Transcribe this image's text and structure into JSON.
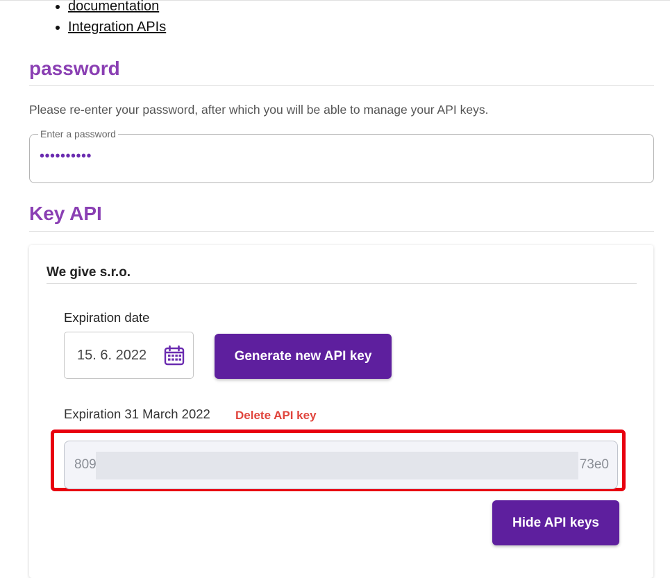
{
  "nav_links": [
    "documentation",
    "Integration APIs"
  ],
  "password_section": {
    "title": "password",
    "hint": "Please re-enter your password, after which you will be able to manage your API keys.",
    "field_label": "Enter a password",
    "field_value": "••••••••••"
  },
  "key_section": {
    "title": "Key API",
    "company": "We give s.r.o.",
    "expiration_label": "Expiration date",
    "date_value": "15. 6. 2022",
    "generate_button": "Generate new API key",
    "current_expiration": "Expiration 31 March 2022",
    "delete_link": "Delete API key",
    "key_prefix": "809",
    "key_suffix": "73e0",
    "hide_button": "Hide API keys"
  },
  "colors": {
    "heading": "#8a3fb3",
    "primary_button": "#5e1f9e",
    "danger": "#e0443c",
    "highlight_frame": "#e8000f"
  },
  "icons": [
    "calendar-icon"
  ]
}
